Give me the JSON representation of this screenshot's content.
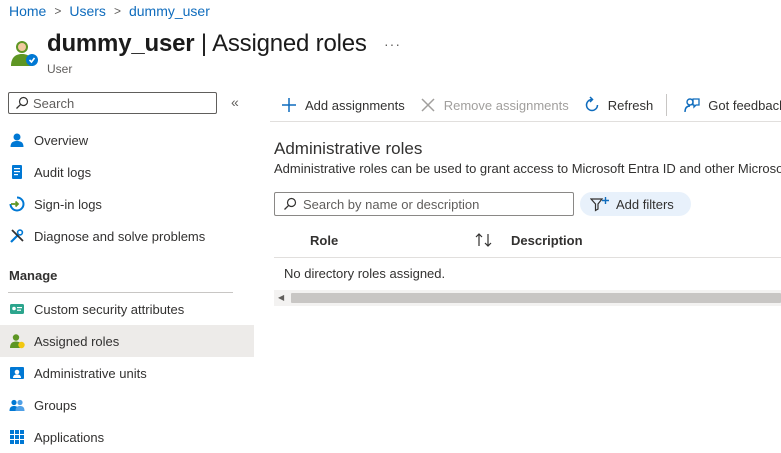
{
  "breadcrumb": [
    "Home",
    "Users",
    "dummy_user"
  ],
  "header": {
    "title_bold": "dummy_user",
    "title_sep": " | ",
    "title_rest": "Assigned roles",
    "more": "···",
    "subtitle": "User"
  },
  "sidebar": {
    "search_placeholder": "Search",
    "collapse_icon": "«",
    "items": [
      {
        "label": "Overview",
        "icon": "user-overview-icon"
      },
      {
        "label": "Audit logs",
        "icon": "audit-log-icon"
      },
      {
        "label": "Sign-in logs",
        "icon": "sign-in-icon"
      },
      {
        "label": "Diagnose and solve problems",
        "icon": "wrench-icon"
      }
    ],
    "manage_label": "Manage",
    "manage_items": [
      {
        "label": "Custom security attributes",
        "icon": "security-attributes-icon"
      },
      {
        "label": "Assigned roles",
        "icon": "assigned-roles-icon",
        "active": true
      },
      {
        "label": "Administrative units",
        "icon": "admin-units-icon"
      },
      {
        "label": "Groups",
        "icon": "groups-icon"
      },
      {
        "label": "Applications",
        "icon": "applications-icon"
      }
    ]
  },
  "toolbar": {
    "add": "Add assignments",
    "remove": "Remove assignments",
    "refresh": "Refresh",
    "feedback": "Got feedback"
  },
  "content": {
    "section_title": "Administrative roles",
    "section_desc": "Administrative roles can be used to grant access to Microsoft Entra ID and other Microso",
    "search_placeholder": "Search by name or description",
    "add_filters": "Add filters",
    "columns": [
      "Role",
      "Description"
    ],
    "empty_message": "No directory roles assigned."
  },
  "colors": {
    "accent": "#0f6cbd",
    "active_bg": "#edebe9",
    "pill_bg": "#e8f1fb"
  }
}
